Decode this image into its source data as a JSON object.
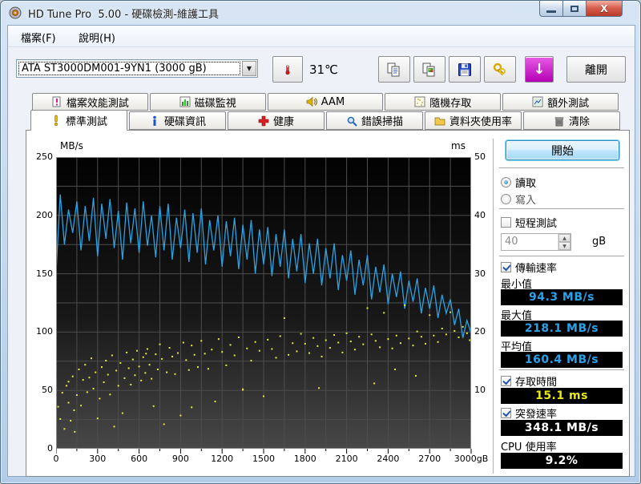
{
  "window": {
    "title": "HD Tune Pro  5.00 - 硬碟檢測-維護工具"
  },
  "menu": {
    "file": "檔案(F)",
    "help": "說明(H)"
  },
  "toolbar": {
    "drive": "ATA    ST3000DM001-9YN1 (3000 gB)",
    "temperature": "31℃",
    "update_glyph": "↓",
    "exit_label": "離開",
    "icons": [
      "thermometer-icon",
      "copy-text-icon",
      "copy-image-icon",
      "save-icon",
      "options-icon",
      "update-icon"
    ]
  },
  "tabs_row1": [
    {
      "label": "檔案效能測試",
      "icon": "file-benchmark-icon"
    },
    {
      "label": "磁碟監視",
      "icon": "disk-monitor-icon"
    },
    {
      "label": "AAM",
      "icon": "speaker-icon"
    },
    {
      "label": "隨機存取",
      "icon": "random-access-icon"
    },
    {
      "label": "額外測試",
      "icon": "extra-tests-icon"
    }
  ],
  "tabs_row2": [
    {
      "label": "標準測試",
      "icon": "exclamation-icon",
      "active": true
    },
    {
      "label": "硬碟資訊",
      "icon": "info-icon"
    },
    {
      "label": "健康",
      "icon": "health-cross-icon"
    },
    {
      "label": "錯誤掃描",
      "icon": "magnifier-icon"
    },
    {
      "label": "資料夾使用率",
      "icon": "folder-icon"
    },
    {
      "label": "清除",
      "icon": "trash-icon"
    }
  ],
  "controls": {
    "start_label": "開始",
    "read_label": "讀取",
    "write_label": "寫入",
    "short_test_label": "短程測試",
    "short_test_value": "40",
    "short_test_unit": "gB",
    "transfer_label": "傳輸速率",
    "min_label": "最小值",
    "min_value": "94.3 MB/s",
    "max_label": "最大值",
    "max_value": "218.1 MB/s",
    "avg_label": "平均值",
    "avg_value": "160.4 MB/s",
    "access_label": "存取時間",
    "access_value": "15.1 ms",
    "burst_label": "突發速率",
    "burst_value": "348.1 MB/s",
    "cpu_label": "CPU 使用率",
    "cpu_value": "9.2%"
  },
  "chart_data": {
    "type": "line",
    "subtype": "benchmark line + access-time scatter",
    "left_axis": {
      "label": "MB/s",
      "min": 0,
      "max": 250,
      "ticks": [
        250,
        200,
        150,
        100,
        50,
        0
      ]
    },
    "right_axis": {
      "label": "ms",
      "min": 0,
      "max": 50,
      "ticks": [
        50,
        40,
        30,
        20,
        10
      ]
    },
    "x_axis": {
      "min": 0,
      "max": 3000,
      "minor_step": 150,
      "tick_labels": [
        "0",
        "300",
        "600",
        "900",
        "1200",
        "1500",
        "1800",
        "2100",
        "2400",
        "2700",
        "3000gB"
      ]
    },
    "grid": {
      "on": true,
      "color": "#4d4d4d"
    },
    "series": [
      {
        "name": "transfer-rate",
        "axis": "left",
        "color": "#2da2e2",
        "x_step": 30,
        "values": [
          152,
          218,
          175,
          205,
          185,
          212,
          170,
          208,
          178,
          215,
          165,
          210,
          180,
          214,
          172,
          204,
          162,
          211,
          176,
          206,
          168,
          212,
          174,
          200,
          164,
          208,
          170,
          210,
          162,
          198,
          172,
          205,
          160,
          202,
          168,
          206,
          158,
          196,
          170,
          200,
          156,
          195,
          165,
          198,
          154,
          192,
          162,
          196,
          150,
          188,
          158,
          190,
          148,
          184,
          156,
          188,
          146,
          180,
          152,
          184,
          142,
          176,
          150,
          180,
          140,
          172,
          146,
          176,
          136,
          166,
          144,
          170,
          132,
          162,
          140,
          166,
          128,
          156,
          134,
          158,
          124,
          150,
          130,
          152,
          120,
          144,
          126,
          146,
          116,
          138,
          120,
          140,
          112,
          132,
          116,
          128,
          106,
          120,
          95,
          110,
          99
        ]
      },
      {
        "name": "access-time",
        "axis": "right",
        "color": "#e8e83c",
        "points": [
          [
            15,
            7.2
          ],
          [
            30,
            5.1
          ],
          [
            45,
            9.6
          ],
          [
            60,
            3.4
          ],
          [
            75,
            10.8
          ],
          [
            90,
            7.9
          ],
          [
            105,
            4.8
          ],
          [
            120,
            12.4
          ],
          [
            135,
            2.9
          ],
          [
            150,
            9.2
          ],
          [
            165,
            13.6
          ],
          [
            180,
            7.4
          ],
          [
            195,
            11.8
          ],
          [
            210,
            14.4
          ],
          [
            225,
            9.7
          ],
          [
            240,
            12.2
          ],
          [
            255,
            15.5
          ],
          [
            270,
            10.3
          ],
          [
            285,
            13.1
          ],
          [
            300,
            5.2
          ],
          [
            315,
            8.6
          ],
          [
            330,
            14.0
          ],
          [
            345,
            11.4
          ],
          [
            360,
            15.1
          ],
          [
            375,
            12.7
          ],
          [
            390,
            9.3
          ],
          [
            405,
            16.0
          ],
          [
            420,
            3.8
          ],
          [
            435,
            13.4
          ],
          [
            450,
            10.8
          ],
          [
            465,
            14.7
          ],
          [
            480,
            6.1
          ],
          [
            495,
            12.1
          ],
          [
            510,
            16.5
          ],
          [
            525,
            13.8
          ],
          [
            540,
            11.0
          ],
          [
            555,
            15.3
          ],
          [
            570,
            12.6
          ],
          [
            585,
            16.8
          ],
          [
            600,
            14.1
          ],
          [
            615,
            11.7
          ],
          [
            630,
            15.7
          ],
          [
            645,
            13.0
          ],
          [
            660,
            17.1
          ],
          [
            675,
            14.4
          ],
          [
            690,
            12.0
          ],
          [
            705,
            7.3
          ],
          [
            720,
            16.2
          ],
          [
            735,
            13.6
          ],
          [
            750,
            17.9
          ],
          [
            765,
            15.4
          ],
          [
            780,
            4.2
          ],
          [
            800,
            13.1
          ],
          [
            820,
            17.3
          ],
          [
            840,
            15.8
          ],
          [
            860,
            12.8
          ],
          [
            880,
            16.4
          ],
          [
            900,
            5.7
          ],
          [
            920,
            18.2
          ],
          [
            940,
            15.2
          ],
          [
            960,
            13.5
          ],
          [
            980,
            17.7
          ],
          [
            1000,
            16.1
          ],
          [
            1025,
            14.0
          ],
          [
            1050,
            18.5
          ],
          [
            1075,
            16.3
          ],
          [
            1100,
            13.7
          ],
          [
            1125,
            17.0
          ],
          [
            1150,
            8.1
          ],
          [
            1175,
            18.8
          ],
          [
            1200,
            16.6
          ],
          [
            1230,
            14.3
          ],
          [
            1260,
            17.8
          ],
          [
            1290,
            16.0
          ],
          [
            1320,
            19.1
          ],
          [
            1350,
            10.1
          ],
          [
            1380,
            17.2
          ],
          [
            1410,
            15.1
          ],
          [
            1440,
            18.3
          ],
          [
            1470,
            16.8
          ],
          [
            1500,
            9.0
          ],
          [
            1530,
            18.7
          ],
          [
            1560,
            17.1
          ],
          [
            1590,
            15.6
          ],
          [
            1620,
            19.3
          ],
          [
            1650,
            22.4
          ],
          [
            1680,
            16.1
          ],
          [
            1710,
            18.1
          ],
          [
            1740,
            16.7
          ],
          [
            1770,
            19.7
          ],
          [
            1800,
            18.0
          ],
          [
            1830,
            16.4
          ],
          [
            1860,
            19.0
          ],
          [
            1890,
            17.6
          ],
          [
            1920,
            15.8
          ],
          [
            1950,
            18.6
          ],
          [
            1980,
            17.3
          ],
          [
            2010,
            19.5
          ],
          [
            2040,
            18.2
          ],
          [
            2070,
            16.5
          ],
          [
            2100,
            19.8
          ],
          [
            2130,
            18.4
          ],
          [
            2160,
            17.0
          ],
          [
            2190,
            19.2
          ],
          [
            2220,
            17.9
          ],
          [
            2250,
            24.1
          ],
          [
            2280,
            19.6
          ],
          [
            2310,
            18.5
          ],
          [
            2340,
            17.4
          ],
          [
            2370,
            23.3
          ],
          [
            2400,
            18.8
          ],
          [
            2430,
            17.2
          ],
          [
            2460,
            19.4
          ],
          [
            2490,
            18.1
          ],
          [
            2520,
            24.6
          ],
          [
            2550,
            18.9
          ],
          [
            2580,
            17.7
          ],
          [
            2610,
            20.1
          ],
          [
            2640,
            19.2
          ],
          [
            2670,
            18.0
          ],
          [
            2700,
            22.9
          ],
          [
            2730,
            19.4
          ],
          [
            2760,
            18.3
          ],
          [
            2790,
            20.6
          ],
          [
            2820,
            19.6
          ],
          [
            2850,
            23.4
          ],
          [
            2880,
            20.2
          ],
          [
            2910,
            19.1
          ],
          [
            2940,
            20.9
          ],
          [
            2970,
            19.8
          ],
          [
            2990,
            18.6
          ],
          [
            1900,
            10.4
          ],
          [
            2300,
            11.2
          ],
          [
            2600,
            12.5
          ],
          [
            980,
            7.1
          ],
          [
            1350,
            10.2
          ],
          [
            2450,
            13.6
          ],
          [
            650,
            16.3
          ],
          [
            130,
            6.6
          ],
          [
            90,
            11.5
          ]
        ]
      }
    ],
    "results": {
      "min_mbs": 94.3,
      "max_mbs": 218.1,
      "avg_mbs": 160.4,
      "access_ms": 15.1,
      "burst_mbs": 348.1,
      "cpu_pct": 9.2
    }
  }
}
